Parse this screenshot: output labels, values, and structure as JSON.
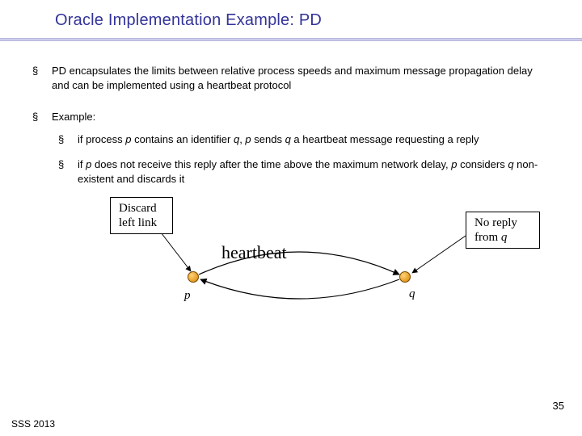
{
  "title": "Oracle Implementation Example: PD",
  "bullets": [
    {
      "text": "PD encapsulates the limits between relative process speeds and maximum message propagation delay and can be implemented using a heartbeat protocol"
    },
    {
      "text": "Example:",
      "sub": [
        {
          "prefix": "if process ",
          "p": "p",
          "mid1": " contains an identifier ",
          "q1": "q",
          "mid2": ", ",
          "p2": "p",
          "mid3": " sends ",
          "q2": "q",
          "tail": " a heartbeat message requesting a reply"
        },
        {
          "prefix": "if ",
          "p": "p",
          "mid1": " does not receive this reply after the time above the maximum network delay, ",
          "p2": "p",
          "mid2": " considers ",
          "q1": "q",
          "tail": " non-existent and discards it"
        }
      ]
    }
  ],
  "diagram": {
    "box_left_l1": "Discard",
    "box_left_l2": "left link",
    "box_right_l1": "No reply",
    "box_right_l2_pre": "from ",
    "box_right_l2_q": "q",
    "heartbeat": "heartbeat",
    "p": "p",
    "q": "q"
  },
  "page_number": "35",
  "footer": "SSS 2013"
}
